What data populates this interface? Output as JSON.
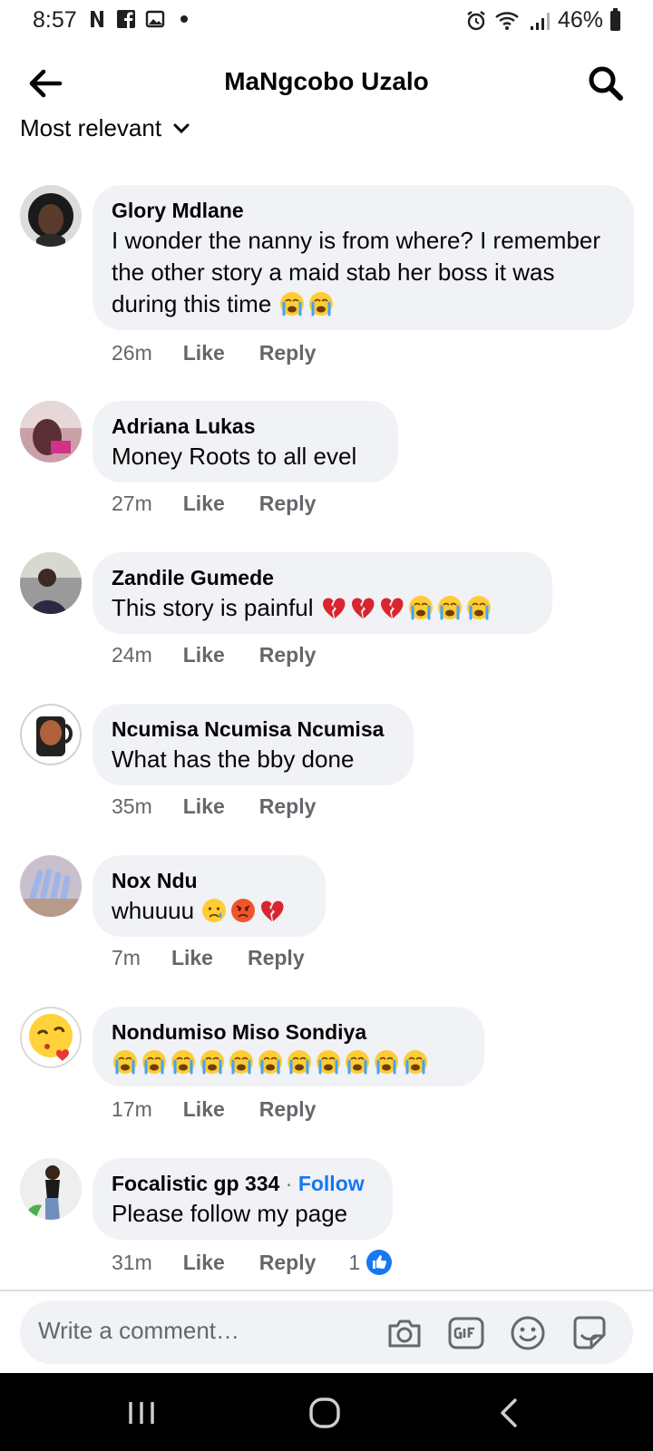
{
  "status_bar": {
    "time": "8:57",
    "battery": "46%"
  },
  "header": {
    "title": "MaNgcobo Uzalo"
  },
  "sort": {
    "label": "Most relevant"
  },
  "comments": [
    {
      "author": "Glory Mdlane",
      "text": "I wonder the nanny is from where? I remember the other story a maid stab her boss it was during this time",
      "emojis": [
        "crying",
        "crying"
      ],
      "time": "26m",
      "like": "Like",
      "reply": "Reply"
    },
    {
      "author": "Adriana Lukas",
      "text": "Money Roots to all evel",
      "emojis": [],
      "time": "27m",
      "like": "Like",
      "reply": "Reply"
    },
    {
      "author": "Zandile Gumede",
      "text": "This story is painful",
      "emojis": [
        "broken-heart",
        "broken-heart",
        "broken-heart",
        "crying",
        "crying",
        "crying"
      ],
      "time": "24m",
      "like": "Like",
      "reply": "Reply"
    },
    {
      "author": "Ncumisa Ncumisa Ncumisa",
      "text": "What has the bby done",
      "emojis": [],
      "time": "35m",
      "like": "Like",
      "reply": "Reply"
    },
    {
      "author": "Nox Ndu",
      "text": "whuuuu",
      "emojis": [
        "sad-tear",
        "angry",
        "broken-heart"
      ],
      "time": "7m",
      "like": "Like",
      "reply": "Reply"
    },
    {
      "author": "Nondumiso Miso Sondiya",
      "text": "",
      "emojis": [
        "crying",
        "crying",
        "crying",
        "crying",
        "crying",
        "crying",
        "crying",
        "crying",
        "crying",
        "crying",
        "crying"
      ],
      "time": "17m",
      "like": "Like",
      "reply": "Reply"
    },
    {
      "author": "Focalistic gp 334",
      "follow": "Follow",
      "text": "Please follow my page",
      "emojis": [],
      "time": "31m",
      "like": "Like",
      "reply": "Reply",
      "reaction_count": "1",
      "reaction_icon": "thumbs-up-icon"
    }
  ],
  "composer": {
    "placeholder": "Write a comment…"
  },
  "colors": {
    "bubble": "#f0f2f5",
    "link": "#1877f2",
    "meta": "#65676b"
  }
}
